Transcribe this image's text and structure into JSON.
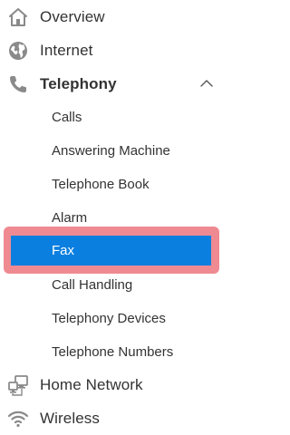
{
  "nav": {
    "overview": {
      "label": "Overview",
      "icon": "home-icon"
    },
    "internet": {
      "label": "Internet",
      "icon": "globe-icon"
    },
    "telephony": {
      "label": "Telephony",
      "icon": "phone-icon",
      "expanded": true
    },
    "telephony_sub": {
      "calls": "Calls",
      "answering_machine": "Answering Machine",
      "telephone_book": "Telephone Book",
      "alarm": "Alarm",
      "fax": "Fax",
      "call_handling": "Call Handling",
      "telephony_devices": "Telephony Devices",
      "telephone_numbers": "Telephone Numbers"
    },
    "home_network": {
      "label": "Home Network",
      "icon": "network-icon"
    },
    "wireless": {
      "label": "Wireless",
      "icon": "wifi-icon"
    }
  },
  "colors": {
    "selected_background": "#0b7fe0",
    "highlight_frame": "#ef8a92",
    "icon_gray": "#8a8a8a",
    "text": "#333333"
  }
}
